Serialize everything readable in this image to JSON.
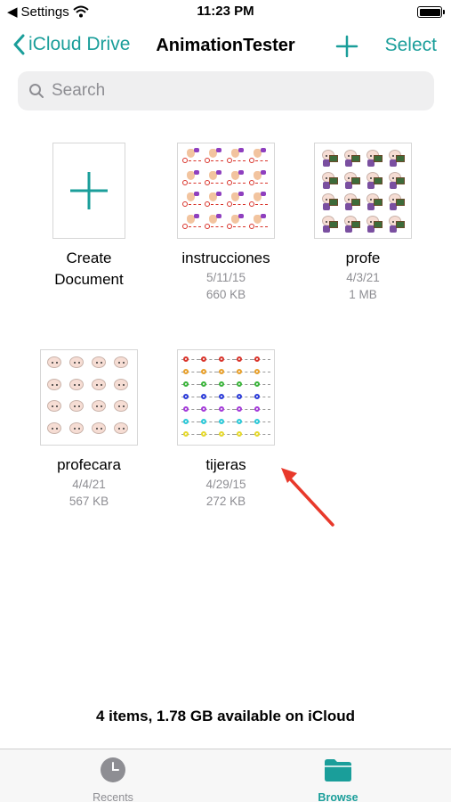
{
  "status_bar": {
    "back_app": "Settings",
    "time": "11:23 PM"
  },
  "nav": {
    "back_label": "iCloud Drive",
    "title": "AnimationTester",
    "select_label": "Select"
  },
  "search": {
    "placeholder": "Search"
  },
  "create": {
    "line1": "Create",
    "line2": "Document"
  },
  "files": [
    {
      "name": "instrucciones",
      "date": "5/11/15",
      "size": "660 KB"
    },
    {
      "name": "profe",
      "date": "4/3/21",
      "size": "1 MB"
    },
    {
      "name": "profecara",
      "date": "4/4/21",
      "size": "567 KB"
    },
    {
      "name": "tijeras",
      "date": "4/29/15",
      "size": "272 KB"
    }
  ],
  "footer": {
    "summary": "4 items, 1.78 GB available on iCloud"
  },
  "tabbar": {
    "recents_label": "Recents",
    "browse_label": "Browse"
  },
  "colors": {
    "accent": "#1a9e9a",
    "annotation_arrow": "#e8392b",
    "secondary_text": "#8e8e93"
  }
}
